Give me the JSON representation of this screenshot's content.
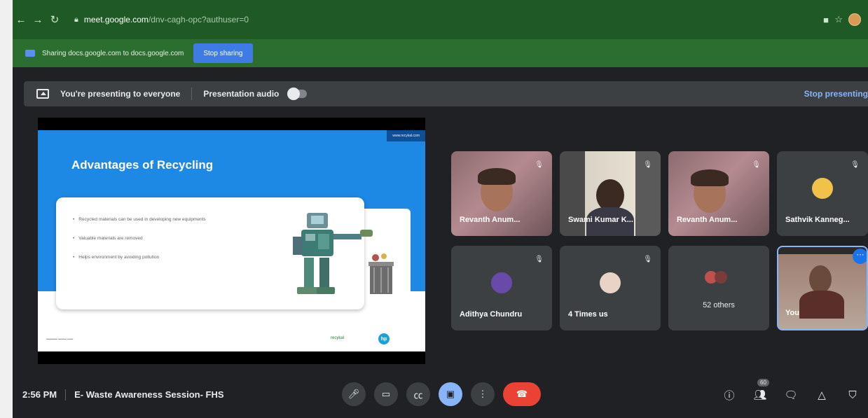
{
  "browser": {
    "url_host": "meet.google.com",
    "url_path": "/dnv-cagh-opc?authuser=0",
    "nav_icons": [
      "back-icon",
      "forward-icon",
      "reload-icon"
    ]
  },
  "sharing_bar": {
    "text": "Sharing docs.google.com to docs.google.com",
    "stop_label": "Stop sharing"
  },
  "present_bar": {
    "presenting_text": "You're presenting to everyone",
    "audio_label": "Presentation audio",
    "audio_enabled": false,
    "stop_label": "Stop presenting"
  },
  "slide": {
    "url_tag": "www.recykal.com",
    "title": "Advantages of Recycling",
    "bullets": [
      "Recycled materials can be used in developing new equipments",
      "Valuable materials are removed",
      "Helps environment by avoiding pollution"
    ],
    "logo_recykal": "recykal",
    "logo_hp": "hp"
  },
  "participants": [
    {
      "name": "Revanth Anum...",
      "muted": true
    },
    {
      "name": "Swami Kumar K...",
      "muted": true
    },
    {
      "name": "Revanth Anum...",
      "muted": true
    },
    {
      "name": "Sathvik Kanneg...",
      "muted": true
    },
    {
      "name": "Adithya Chundru",
      "muted": true
    },
    {
      "name": "4 Times us",
      "muted": true
    },
    {
      "name": "52 others",
      "muted": false
    },
    {
      "name": "You",
      "muted": false
    }
  ],
  "bottom_bar": {
    "time": "2:56 PM",
    "meeting_title": "E- Waste Awareness Session- FHS",
    "participant_count": "60"
  },
  "colors": {
    "meet_bg": "#202124",
    "chrome_green": "#1f5a26",
    "accent_blue": "#8ab4f8",
    "hangup_red": "#ea4335",
    "slide_blue": "#1e88e5"
  }
}
